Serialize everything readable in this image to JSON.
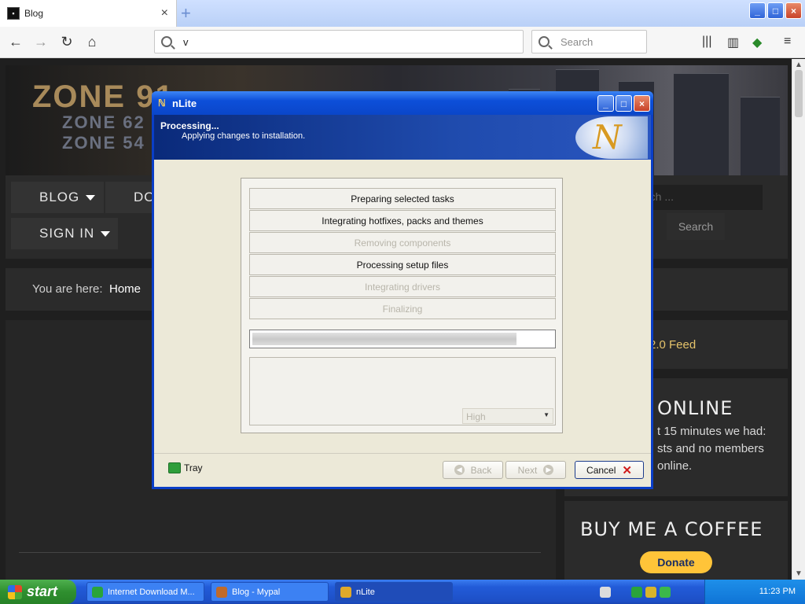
{
  "browser": {
    "tab_title": "Blog",
    "tab_close": "×",
    "new_tab": "+",
    "url_value": "v",
    "search_placeholder": "Search",
    "window_buttons": [
      "_",
      "□",
      "×"
    ]
  },
  "site": {
    "logo_line1": "ZONE 91",
    "logo_line2": "ZONE 62",
    "logo_line3": "ZONE 54",
    "menu": [
      {
        "label": "BLOG"
      },
      {
        "label": "DO"
      },
      {
        "label": "SIGN IN"
      }
    ],
    "search_input_partial": "rch ...",
    "search_button": "Search",
    "breadcrumb_label": "You are here:",
    "breadcrumb_home": "Home",
    "rss_feed": "2.0 Feed",
    "online_title": "ONLINE",
    "online_lines": [
      "t 15 minutes we had:",
      "sts and no members",
      "online."
    ],
    "coffee_title": "BUY ME A COFFEE",
    "donate": "Donate"
  },
  "dialog": {
    "title": "nLite",
    "banner_title": "Processing...",
    "banner_subtitle": "Applying changes to installation.",
    "logo_glyph": "N",
    "tasks": [
      {
        "label": "Preparing selected tasks",
        "state": "active"
      },
      {
        "label": "Integrating hotfixes, packs and themes",
        "state": "active"
      },
      {
        "label": "Removing components",
        "state": "disabled"
      },
      {
        "label": "Processing setup files",
        "state": "active"
      },
      {
        "label": "Integrating drivers",
        "state": "disabled"
      },
      {
        "label": "Finalizing",
        "state": "disabled"
      }
    ],
    "progress_fraction": 0.88,
    "priority_value": "High",
    "tray_label": "Tray",
    "back_label": "Back",
    "next_label": "Next",
    "cancel_label": "Cancel"
  },
  "taskbar": {
    "start_label": "start",
    "items": [
      {
        "label": "Internet Download M...",
        "active": false
      },
      {
        "label": "Blog - Mypal",
        "active": false
      },
      {
        "label": "nLite",
        "active": true
      }
    ],
    "clock": "11:23 PM"
  }
}
